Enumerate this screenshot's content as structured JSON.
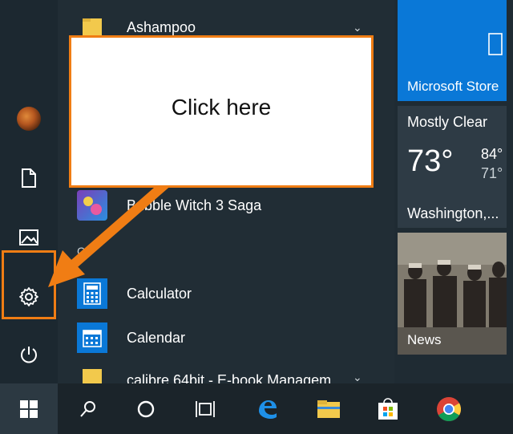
{
  "callout": {
    "text": "Click here"
  },
  "rail": {
    "items": [
      {
        "name": "user-avatar",
        "label": ""
      },
      {
        "name": "documents",
        "label": ""
      },
      {
        "name": "pictures",
        "label": ""
      },
      {
        "name": "settings",
        "label": ""
      },
      {
        "name": "power",
        "label": ""
      }
    ]
  },
  "apps": [
    {
      "label": "Ashampoo",
      "icon": "folder-icon",
      "expandable": true
    },
    {
      "label": "Bubble Witch 3 Saga",
      "icon": "bubble-witch-icon",
      "expandable": false
    },
    {
      "label": "Calculator",
      "icon": "calculator-icon",
      "expandable": false
    },
    {
      "label": "Calendar",
      "icon": "calendar-icon",
      "expandable": false
    },
    {
      "label": "calibre 64bit - E-book Managem",
      "icon": "folder-icon",
      "expandable": true
    }
  ],
  "section_letters": {
    "c": "C"
  },
  "tiles": {
    "store": {
      "label": "Microsoft Store"
    },
    "weather": {
      "condition": "Mostly Clear",
      "temp": "73°",
      "high": "84°",
      "low": "71°",
      "city": "Washington,..."
    },
    "news": {
      "label": "News"
    }
  },
  "taskbar": {
    "items": [
      "start",
      "search",
      "cortana",
      "task-view",
      "edge",
      "file-explorer",
      "store",
      "chrome"
    ]
  },
  "colors": {
    "accent_orange": "#f07d14",
    "tile_blue": "#0a78d7",
    "app_icon_blue": "#0a78d7",
    "background": "#1f2b33"
  }
}
